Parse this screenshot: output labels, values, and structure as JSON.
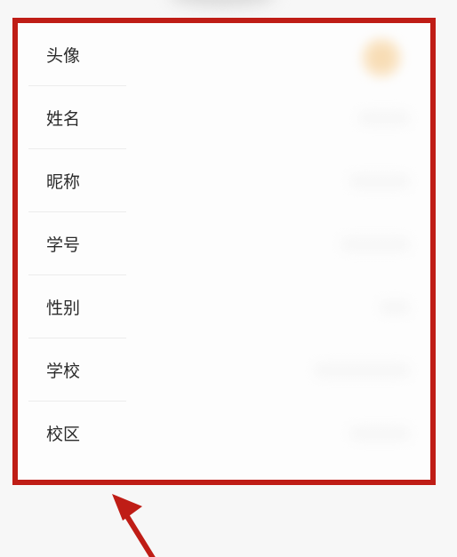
{
  "profile": {
    "rows": [
      {
        "label": "头像"
      },
      {
        "label": "姓名"
      },
      {
        "label": "昵称"
      },
      {
        "label": "学号"
      },
      {
        "label": "性别"
      },
      {
        "label": "学校"
      },
      {
        "label": "校区"
      }
    ]
  },
  "colors": {
    "highlight_border": "#bf1d16",
    "arrow": "#bf1d16",
    "avatar": "#f0b35a"
  },
  "icons": {
    "annotation_arrow": "arrow-up-left-icon"
  }
}
